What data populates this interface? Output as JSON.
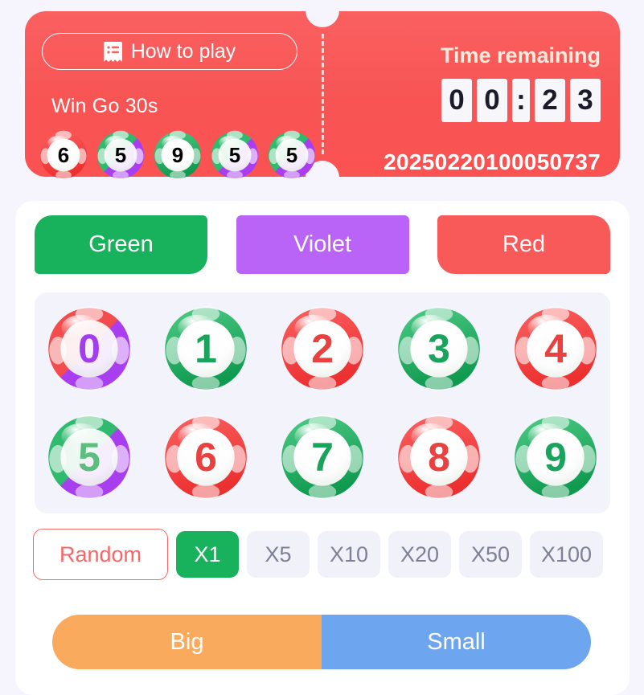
{
  "header": {
    "how_to_play_label": "How to play",
    "how_to_play_icon": "rules-book-icon",
    "game_title": "Win Go 30s",
    "timer_label": "Time remaining",
    "timer": {
      "d1": "0",
      "d2": "0",
      "colon": ":",
      "d3": "2",
      "d4": "3"
    },
    "period_id": "20250220100050737",
    "history_balls": [
      {
        "number": "6",
        "kind": "red"
      },
      {
        "number": "5",
        "kind": "green-violet"
      },
      {
        "number": "9",
        "kind": "green"
      },
      {
        "number": "5",
        "kind": "green-violet"
      },
      {
        "number": "5",
        "kind": "green-violet"
      }
    ]
  },
  "colors": [
    {
      "label": "Green",
      "hex": "#19b25c"
    },
    {
      "label": "Violet",
      "hex": "#b964f7"
    },
    {
      "label": "Red",
      "hex": "#f85a5a"
    }
  ],
  "numbers": {
    "row1": [
      {
        "number": "0",
        "kind": "red-violet"
      },
      {
        "number": "1",
        "kind": "green"
      },
      {
        "number": "2",
        "kind": "red"
      },
      {
        "number": "3",
        "kind": "green"
      },
      {
        "number": "4",
        "kind": "red"
      }
    ],
    "row2": [
      {
        "number": "5",
        "kind": "green-violet"
      },
      {
        "number": "6",
        "kind": "red"
      },
      {
        "number": "7",
        "kind": "green"
      },
      {
        "number": "8",
        "kind": "red"
      },
      {
        "number": "9",
        "kind": "green"
      }
    ]
  },
  "multipliers": {
    "random_label": "Random",
    "options": [
      "X1",
      "X5",
      "X10",
      "X20",
      "X50",
      "X100"
    ],
    "selected": "X1"
  },
  "bigsmall": {
    "big_label": "Big",
    "big_hex": "#f9aa5c",
    "small_label": "Small",
    "small_hex": "#6ea5ef"
  },
  "theme": {
    "page_bg": "#f6f5fd",
    "ticket_bg": "#f85454",
    "card_bg": "#ffffff",
    "grid_bg": "#f3f3fb"
  }
}
